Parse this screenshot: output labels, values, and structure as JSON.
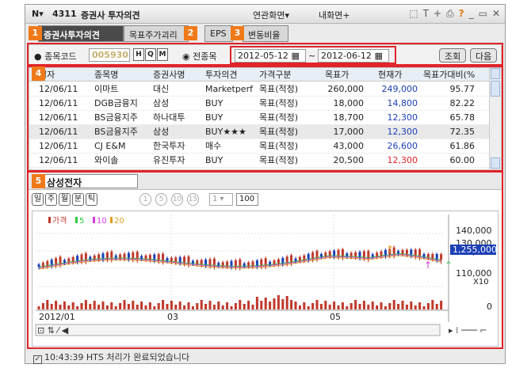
{
  "window": {
    "menu_label": "N▾",
    "screen_no": "4311",
    "title": "증권사 투자의견",
    "linked_screen": "연관화면▾",
    "my_screen": "내화면+",
    "icons": [
      "window-link-icon",
      "text-icon",
      "plus-icon",
      "print-icon",
      "help-icon",
      "minimize-icon",
      "maximize-icon",
      "close-icon"
    ]
  },
  "tabs": [
    "증권사투자의견",
    "목표주가괴리율",
    "EPS",
    "변동비율"
  ],
  "badges": {
    "b1": "1",
    "b2": "2",
    "b3": "3",
    "b4": "4",
    "b5": "5"
  },
  "filter": {
    "code_label": "종목코드",
    "code_value": "005930",
    "all_label": "전종목",
    "date_from": "2012-05-12",
    "date_sep": "~",
    "date_to": "2012-06-12",
    "search_btn": "조회",
    "next_btn": "다음"
  },
  "grid": {
    "headers": [
      "일자",
      "종목명",
      "증권사명",
      "투자의견",
      "가격구분",
      "목표가",
      "현재가",
      "목표가대비(%"
    ],
    "rows": [
      {
        "date": "12/06/11",
        "name": "이마트",
        "broker": "대신",
        "opinion": "Marketperf",
        "price_type": "목표(적정)",
        "target": "260,000",
        "current": "249,000",
        "ratio": "95.77",
        "current_color": "#1b3fb5"
      },
      {
        "date": "12/06/11",
        "name": "DGB금융지",
        "broker": "삼성",
        "opinion": "BUY",
        "price_type": "목표(적정)",
        "target": "18,000",
        "current": "14,800",
        "ratio": "82.22",
        "current_color": "#1b3fb5"
      },
      {
        "date": "12/06/11",
        "name": "BS금융지주",
        "broker": "하나대투",
        "opinion": "BUY",
        "price_type": "목표(적정)",
        "target": "18,700",
        "current": "12,300",
        "ratio": "65.78",
        "current_color": "#1b3fb5"
      },
      {
        "date": "12/06/11",
        "name": "BS금융지주",
        "broker": "삼성",
        "opinion": "BUY★★★",
        "price_type": "목표(적정)",
        "target": "17,000",
        "current": "12,300",
        "ratio": "72.35",
        "current_color": "#1b3fb5"
      },
      {
        "date": "12/06/11",
        "name": "CJ E&M",
        "broker": "한국투자",
        "opinion": "매수",
        "price_type": "목표(적정)",
        "target": "43,000",
        "current": "26,600",
        "ratio": "61.86",
        "current_color": "#1b3fb5"
      },
      {
        "date": "12/06/11",
        "name": "와이솔",
        "broker": "유진투자",
        "opinion": "BUY",
        "price_type": "목표(적정)",
        "target": "20,500",
        "current": "12,300",
        "ratio": "60.00",
        "current_color": "#e0242a"
      }
    ]
  },
  "chart_panel": {
    "stock_name": "삼성전자",
    "period_buttons": [
      "일",
      "주",
      "월",
      "분",
      "틱"
    ],
    "num_buttons": [
      "1",
      "5",
      "10",
      "15"
    ],
    "select_value": "1",
    "count_value": "100",
    "legend": [
      "가격",
      "5",
      "10",
      "20"
    ],
    "legend_colors": [
      "#c0392b",
      "#2ecc40",
      "#d63ae0",
      "#e0a020"
    ],
    "y_ticks": [
      "140,000",
      "130,000",
      "120,000",
      "110,000"
    ],
    "current_price": "1,255,000",
    "multiplier": "X10",
    "volume_zero": "0",
    "x_labels": [
      "2012/01",
      "03",
      "05"
    ]
  },
  "status": {
    "text": "10:43:39  HTS 처리가 완료되었습니다",
    "checked": "✓"
  }
}
